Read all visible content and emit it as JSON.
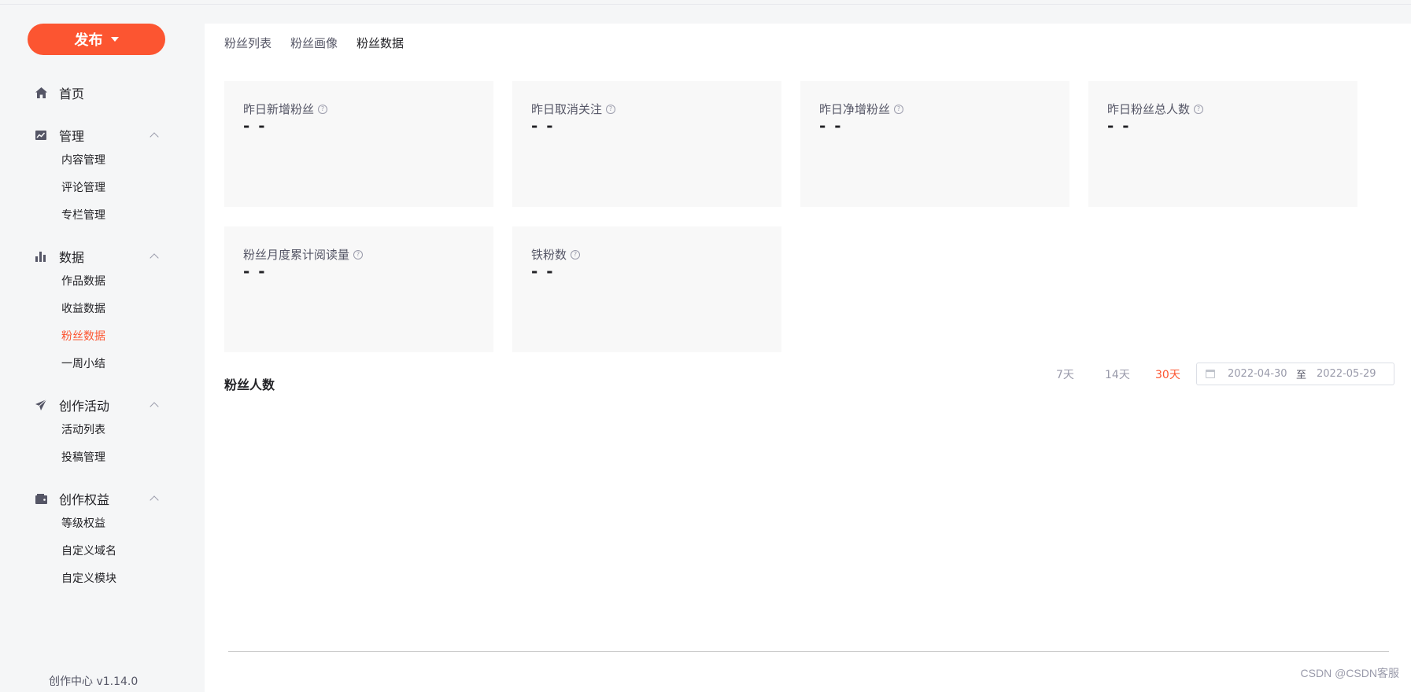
{
  "sidebar": {
    "publish_label": "发布",
    "home_label": "首页",
    "groups": [
      {
        "label": "管理",
        "items": [
          "内容管理",
          "评论管理",
          "专栏管理"
        ]
      },
      {
        "label": "数据",
        "items": [
          "作品数据",
          "收益数据",
          "粉丝数据",
          "一周小结"
        ]
      },
      {
        "label": "创作活动",
        "items": [
          "活动列表",
          "投稿管理"
        ]
      },
      {
        "label": "创作权益",
        "items": [
          "等级权益",
          "自定义域名",
          "自定义模块"
        ]
      }
    ],
    "version": "创作中心 v1.14.0"
  },
  "tabs": [
    "粉丝列表",
    "粉丝画像",
    "粉丝数据"
  ],
  "stats": [
    {
      "title": "昨日新增粉丝",
      "value": "- -"
    },
    {
      "title": "昨日取消关注",
      "value": "- -"
    },
    {
      "title": "昨日净增粉丝",
      "value": "- -"
    },
    {
      "title": "昨日粉丝总人数",
      "value": "- -"
    },
    {
      "title": "粉丝月度累计阅读量",
      "value": "- -"
    },
    {
      "title": "铁粉数",
      "value": "- -"
    }
  ],
  "chart_section": {
    "title": "粉丝人数",
    "ranges": [
      "7天",
      "14天",
      "30天"
    ],
    "date_start": "2022-04-30",
    "date_sep": "至",
    "date_end": "2022-05-29"
  },
  "watermark": "CSDN @CSDN客服",
  "colors": {
    "accent": "#fc5531",
    "card_bg": "#f8f8f8"
  }
}
